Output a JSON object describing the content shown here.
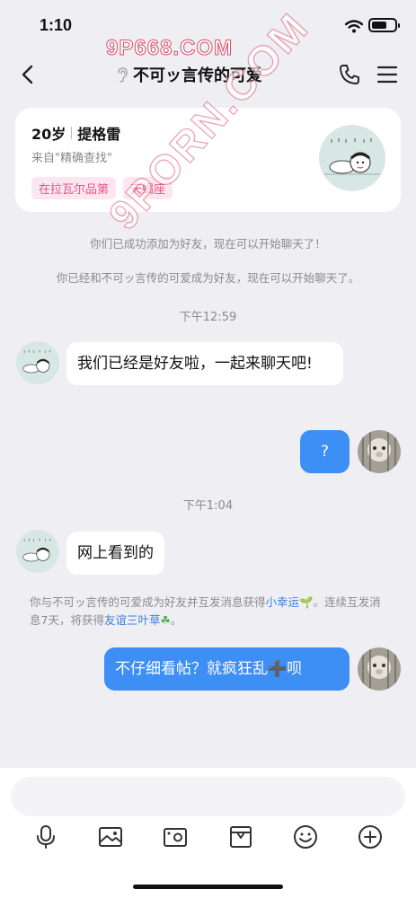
{
  "status": {
    "time": "1:10"
  },
  "watermark": {
    "top": "9P668.COM",
    "diagonal": "9PORN.COM"
  },
  "header": {
    "title": "不可ッ言传的可爱"
  },
  "profile": {
    "age": "20岁",
    "location": "提格雷",
    "source": "来自\"精确查找\"",
    "tags": [
      "在拉瓦尔品第",
      "天蝎座"
    ]
  },
  "system_messages": {
    "added": "你们已成功添加为好友，现在可以开始聊天了！",
    "became_friends": "你已经和不可ッ言传的可爱成为好友，现在可以开始聊天了。",
    "luck_prefix": "你与不可ッ言传的可爱成为好友并互发消息获得",
    "luck_link": "小幸运",
    "luck_middle": "。连续互发消息7天，将获得",
    "clover_link": "友谊三叶草",
    "luck_suffix": "。"
  },
  "timestamps": [
    "下午12:59",
    "下午1:04"
  ],
  "messages": [
    {
      "side": "in",
      "text": "我们已经是好友啦，一起来聊天吧!"
    },
    {
      "side": "out",
      "text": "?"
    },
    {
      "side": "in",
      "text": "网上看到的"
    },
    {
      "side": "out",
      "text": "不仔细看帖？就疯狂乱➕呗"
    }
  ],
  "input": {
    "placeholder": ""
  },
  "toolbar": [
    "voice-icon",
    "image-icon",
    "camera-icon",
    "gift-icon",
    "emoji-icon",
    "plus-icon"
  ],
  "colors": {
    "accent": "#3d8ef5",
    "tag_bg": "#fde6ef",
    "tag_text": "#e2568a",
    "link": "#3b82d9"
  }
}
